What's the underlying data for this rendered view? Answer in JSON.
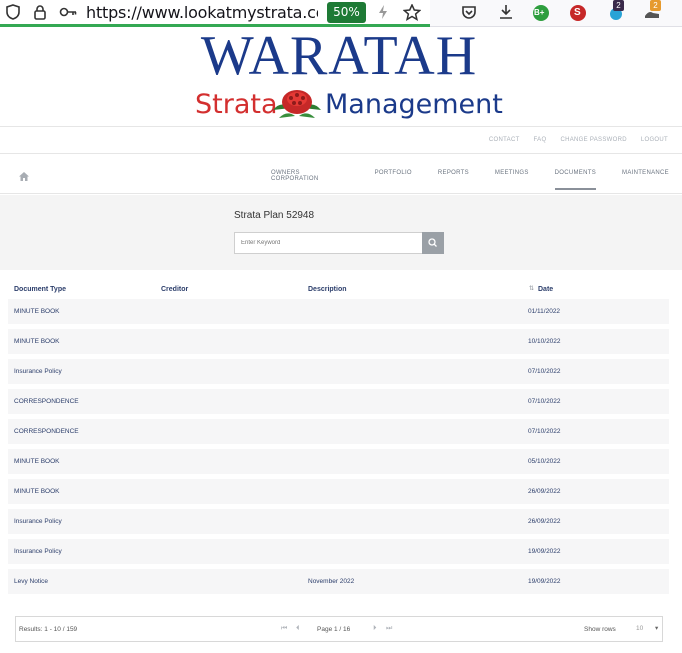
{
  "browser": {
    "url_protocol": "https://",
    "url_host": "www.lookatmystrata.com",
    "zoom": "50%",
    "badge_b": "B+",
    "badge_s": "S",
    "badge_count_a": "2",
    "badge_count_b": "2"
  },
  "logo": {
    "title": "WARATAH",
    "sub_left": "Strata",
    "sub_right": "Management"
  },
  "util_links": [
    "CONTACT",
    "FAQ",
    "CHANGE PASSWORD",
    "LOGOUT"
  ],
  "nav": {
    "items": [
      "OWNERS CORPORATION",
      "PORTFOLIO",
      "REPORTS",
      "MEETINGS",
      "DOCUMENTS",
      "MAINTENANCE"
    ],
    "active": "DOCUMENTS"
  },
  "hero": {
    "plan_title": "Strata Plan 52948",
    "search_placeholder": "Enter Keyword"
  },
  "table": {
    "headers": {
      "doc_type": "Document Type",
      "creditor": "Creditor",
      "description": "Description",
      "date": "Date"
    },
    "rows": [
      {
        "type": "MINUTE BOOK",
        "creditor": "",
        "description": "",
        "date": "01/11/2022"
      },
      {
        "type": "MINUTE BOOK",
        "creditor": "",
        "description": "",
        "date": "10/10/2022"
      },
      {
        "type": "Insurance Policy",
        "creditor": "",
        "description": "",
        "date": "07/10/2022"
      },
      {
        "type": "CORRESPONDENCE",
        "creditor": "",
        "description": "",
        "date": "07/10/2022"
      },
      {
        "type": "CORRESPONDENCE",
        "creditor": "",
        "description": "",
        "date": "07/10/2022"
      },
      {
        "type": "MINUTE BOOK",
        "creditor": "",
        "description": "",
        "date": "05/10/2022"
      },
      {
        "type": "MINUTE BOOK",
        "creditor": "",
        "description": "",
        "date": "26/09/2022"
      },
      {
        "type": "Insurance Policy",
        "creditor": "",
        "description": "",
        "date": "26/09/2022"
      },
      {
        "type": "Insurance Policy",
        "creditor": "",
        "description": "",
        "date": "19/09/2022"
      },
      {
        "type": "Levy Notice",
        "creditor": "",
        "description": "November 2022",
        "date": "19/09/2022"
      }
    ]
  },
  "pager": {
    "results": "Results: 1 - 10 / 159",
    "page": "Page 1 / 16",
    "show_rows_label": "Show rows",
    "show_rows_value": "10"
  }
}
